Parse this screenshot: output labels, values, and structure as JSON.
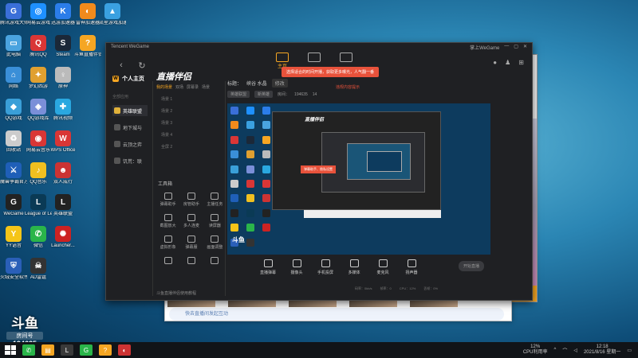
{
  "desktop": {
    "icons": [
      {
        "label": "腾讯游戏大师",
        "color": "#3a6fd8",
        "glyph": "G"
      },
      {
        "label": "网易云游戏",
        "color": "#1e90ff",
        "glyph": "◎"
      },
      {
        "label": "迅游加速器",
        "color": "#2b7de9",
        "glyph": "K"
      },
      {
        "label": "雷神加速器",
        "color": "#f08a1c",
        "glyph": "◐"
      },
      {
        "label": "流星游戏加速器",
        "color": "#3aa0e0",
        "glyph": "▲"
      },
      {
        "label": "此电脑",
        "color": "#4aa3df",
        "glyph": "▭"
      },
      {
        "label": "腾讯QQ",
        "color": "#d93636",
        "glyph": "Q"
      },
      {
        "label": "Steam",
        "color": "#1b2838",
        "glyph": "S"
      },
      {
        "label": "斗鱼直播伴侣",
        "color": "#f5a623",
        "glyph": "?"
      },
      {
        "label": "网络",
        "color": "#3a8fd8",
        "glyph": "⌂"
      },
      {
        "label": "梦幻西游",
        "color": "#e0a030",
        "glyph": "✦"
      },
      {
        "label": "原神",
        "color": "#bbb",
        "glyph": "♀"
      },
      {
        "label": "QQ游戏",
        "color": "#3a9fd8",
        "glyph": "◆"
      },
      {
        "label": "QQ游戏库",
        "color": "#7a8fd8",
        "glyph": "◈"
      },
      {
        "label": "腾讯视频",
        "color": "#2aa8e0",
        "glyph": "✚"
      },
      {
        "label": "回收站",
        "color": "#ccc",
        "glyph": "♻"
      },
      {
        "label": "网易云音乐",
        "color": "#d93636",
        "glyph": "◉"
      },
      {
        "label": "WPS Office",
        "color": "#d93636",
        "glyph": "W"
      },
      {
        "label": "魔兽争霸官方对战平台",
        "color": "#1f5fb8",
        "glyph": "⚔"
      },
      {
        "label": "QQ音乐",
        "color": "#f0c020",
        "glyph": "♪"
      },
      {
        "label": "双人成行",
        "color": "#c33",
        "glyph": "☻"
      },
      {
        "label": "WeGame",
        "color": "#222",
        "glyph": "G"
      },
      {
        "label": "League of Legends",
        "color": "#0a3a55",
        "glyph": "L"
      },
      {
        "label": "英雄联盟",
        "color": "#222",
        "glyph": "L"
      },
      {
        "label": "YY语音",
        "color": "#f5c518",
        "glyph": "Y"
      },
      {
        "label": "微信",
        "color": "#2ab54a",
        "glyph": "✆"
      },
      {
        "label": "Launcher...",
        "color": "#c22",
        "glyph": "✺"
      },
      {
        "label": "火绒安全软件",
        "color": "#2a5fb8",
        "glyph": "⛨"
      },
      {
        "label": "AD雷霆",
        "color": "#333",
        "glyph": "☠"
      }
    ],
    "douyu_logo": {
      "text": "斗鱼",
      "room_label": "房间号",
      "room_number": "194635"
    }
  },
  "back_window": {
    "chat_placeholder": "快去直播间发起互动"
  },
  "app": {
    "title": "Tencent WeGame",
    "top_right_label": "掌上WeGame",
    "tabs": [
      {
        "label": "主页",
        "active": true
      },
      {
        "label": "",
        "active": false
      },
      {
        "label": "",
        "active": false
      }
    ],
    "sidebar": {
      "header": "个人主页",
      "section": "全部应用",
      "items": [
        {
          "label": "英雄联盟",
          "active": true
        },
        {
          "label": "地下城与",
          "active": false
        },
        {
          "label": "云顶之弈",
          "active": false
        },
        {
          "label": "饥荒：联",
          "active": false
        }
      ]
    },
    "douyu": {
      "logo": "直播伴侣",
      "scene_tabs": [
        "我的场景",
        "双场",
        "屏幕录",
        "场景"
      ],
      "scenes": [
        "场景 1",
        "场景 2",
        "场景 3",
        "场景 4",
        "全屏 2"
      ],
      "tools_title": "工具箱",
      "tools": [
        "弹幕助手",
        "房管助手",
        "主播任务",
        "截图放大",
        "多人连麦",
        "读屏器",
        "虚拟形象",
        "弹幕服",
        "画面调整",
        "",
        "",
        ""
      ],
      "footer": "斗鱼直播伴侣使用教程"
    },
    "live": {
      "title_prefix": "标题：",
      "title_value": "峡谷 水晶",
      "edit_label": "修改",
      "notice": "选择适合的时间开播，获取更多曝光，人气翻一番",
      "category_label": "英雄联盟",
      "sub_category": "新英雄",
      "room_label": "房间：",
      "room_value": "194635",
      "hot_value": "14",
      "warning_link": "违规内容提示",
      "preview_popup": "弹幕助手、隐私设置",
      "controls": [
        "直播弹幕",
        "摄像头",
        "手机投屏",
        "多媒体",
        "麦克风",
        "扬声器"
      ],
      "go_live_label": "开始直播",
      "status": [
        "码率：0kb/s",
        "帧率：0",
        "CPU：12%",
        "丢帧：0%"
      ]
    }
  },
  "taskbar": {
    "items": [
      {
        "glyph": "✆",
        "color": "#2ab54a"
      },
      {
        "glyph": "▤",
        "color": "#f5a623"
      },
      {
        "glyph": "L",
        "color": "#3a3a3a"
      },
      {
        "glyph": "G",
        "color": "#2ab54a"
      },
      {
        "glyph": "?",
        "color": "#f5a623"
      },
      {
        "glyph": "◐",
        "color": "#c33"
      }
    ],
    "cpu_percent": "12%",
    "cpu_label": "CPU利用率",
    "time": "12:18",
    "date": "2021/8/16 星期一"
  }
}
